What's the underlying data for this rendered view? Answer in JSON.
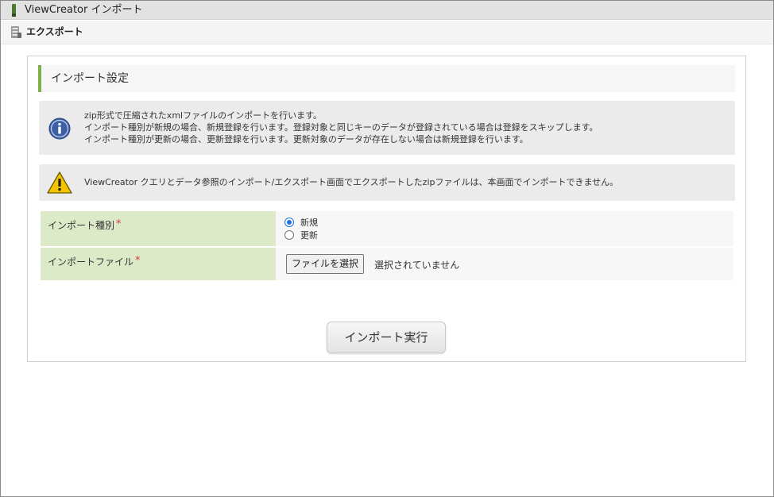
{
  "window": {
    "title": "ViewCreator インポート"
  },
  "subbar": {
    "label": "エクスポート",
    "icon": "database-icon"
  },
  "section": {
    "title": "インポート設定"
  },
  "info_message": {
    "icon": "info-icon",
    "lines": [
      "zip形式で圧縮されたxmlファイルのインポートを行います。",
      "インポート種別が新規の場合、新規登録を行います。登録対象と同じキーのデータが登録されている場合は登録をスキップします。",
      "インポート種別が更新の場合、更新登録を行います。更新対象のデータが存在しない場合は新規登録を行います。"
    ]
  },
  "warning_message": {
    "icon": "warning-icon",
    "text": "ViewCreator クエリとデータ参照のインポート/エクスポート画面でエクスポートしたzipファイルは、本画面でインポートできません。"
  },
  "form": {
    "import_type": {
      "label": "インポート種別",
      "required_mark": "*",
      "options": [
        {
          "label": "新規",
          "selected": true
        },
        {
          "label": "更新",
          "selected": false
        }
      ]
    },
    "import_file": {
      "label": "インポートファイル",
      "required_mark": "*",
      "button_label": "ファイルを選択",
      "status": "選択されていません"
    }
  },
  "actions": {
    "run_label": "インポート実行"
  },
  "colors": {
    "accent": "#7fb04a",
    "label_bg": "#dceac7",
    "required": "#d83b3b",
    "radio_selected": "#1a73e8"
  }
}
